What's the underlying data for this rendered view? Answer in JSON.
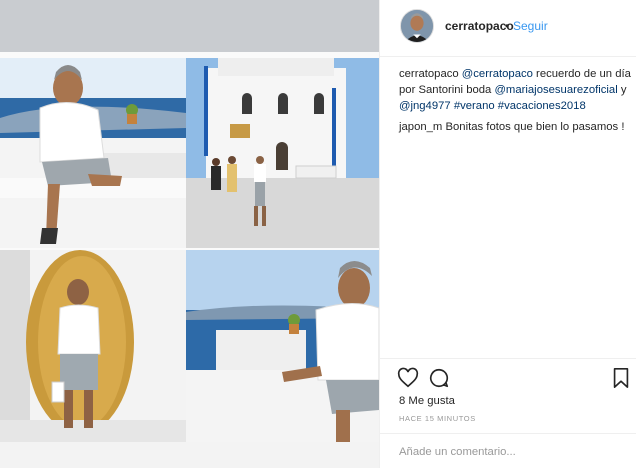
{
  "post": {
    "username": "cerratopaco",
    "separator": "•",
    "follow_label": "Seguir"
  },
  "caption": {
    "user": "cerratopaco",
    "mention_1": "@cerratopaco",
    "text_1": " recuerdo de un día por Santorini boda ",
    "mention_2": "@mariajosesuarezoficial",
    "text_2": " y ",
    "mention_3": "@jng4977",
    "text_3": " ",
    "hashtag_1": "#verano",
    "text_4": " ",
    "hashtag_2": "#vacaciones2018"
  },
  "comments": [
    {
      "user": "japon_m",
      "text": " Bonitas fotos que bien lo pasamos !"
    }
  ],
  "actions": {
    "like_icon": "heart-icon",
    "comment_icon": "comment-bubble-icon",
    "save_icon": "bookmark-icon"
  },
  "likes_label": "8 Me gusta",
  "time_ago": "HACE 15 MINUTOS",
  "comment_input": {
    "placeholder": "Añade un comentario...",
    "value": ""
  },
  "colors": {
    "link": "#003569",
    "follow": "#3897f0",
    "border": "#efefef",
    "muted": "#999999"
  }
}
